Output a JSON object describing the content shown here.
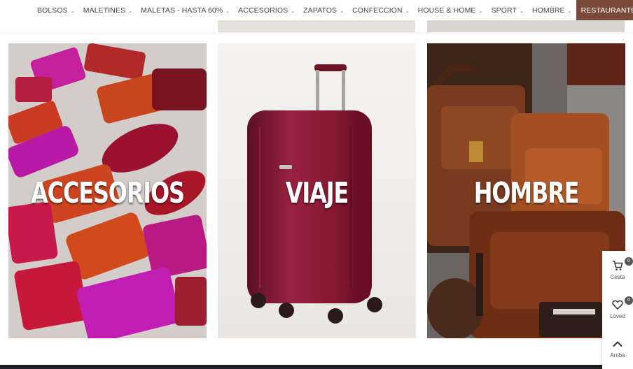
{
  "nav": {
    "items": [
      {
        "label": "BOLSOS",
        "dropdown": true
      },
      {
        "label": "MALETINES",
        "dropdown": true
      },
      {
        "label": "MALETAS - HASTA 60%",
        "dropdown": true
      },
      {
        "label": "ACCESORIOS",
        "dropdown": true
      },
      {
        "label": "ZAPATOS",
        "dropdown": true
      },
      {
        "label": "CONFECCION",
        "dropdown": true
      },
      {
        "label": "HOUSE & HOME",
        "dropdown": true
      },
      {
        "label": "SPORT",
        "dropdown": true
      },
      {
        "label": "HOMBRE",
        "dropdown": true
      }
    ],
    "highlight_label": "RESTAURANTES SB",
    "highlight_color": "#7a4a3a",
    "chevron_icon": "chevron-down-icon"
  },
  "banners": {
    "accesorios": {
      "title": "ACCESORIOS",
      "image": "wallets-and-purses-photo"
    },
    "viaje": {
      "title": "VIAJE",
      "image": "burgundy-suitcase-photo"
    },
    "hombre": {
      "title": "HOMBRE",
      "image": "leather-bags-photo"
    }
  },
  "sidebar": {
    "cart": {
      "label": "Cesta",
      "count": "0",
      "icon": "cart-icon"
    },
    "loved": {
      "label": "Loved",
      "count": "0",
      "icon": "heart-icon"
    },
    "top": {
      "label": "Arriba",
      "icon": "chevron-up-icon"
    }
  }
}
